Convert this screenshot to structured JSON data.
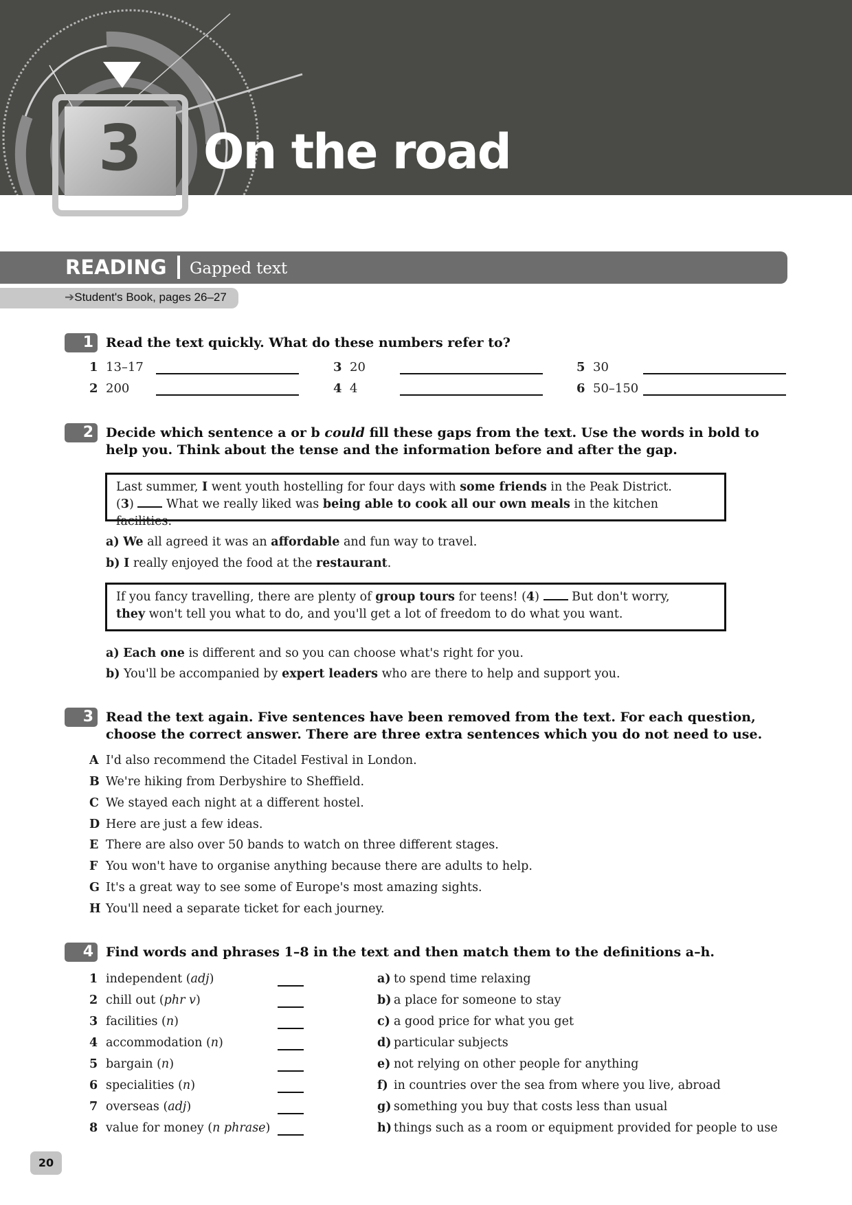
{
  "header": {
    "unit_number": "3",
    "unit_title": "On the road"
  },
  "section": {
    "title": "READING",
    "subtitle": "Gapped text",
    "book_ref_icon": "arrow-right-icon",
    "book_ref": "Student's Book, pages 26–27"
  },
  "exercise1": {
    "number": "1",
    "instruction": "Read the text quickly. What do these numbers refer to?",
    "items": [
      {
        "n": "1",
        "value": "13–17"
      },
      {
        "n": "2",
        "value": "200"
      },
      {
        "n": "3",
        "value": "20"
      },
      {
        "n": "4",
        "value": "4"
      },
      {
        "n": "5",
        "value": "30"
      },
      {
        "n": "6",
        "value": "50–150"
      }
    ]
  },
  "exercise2": {
    "number": "2",
    "instruction_pre": "Decide which sentence a or b ",
    "instruction_em": "could",
    "instruction_post": " fill these gaps from the text. Use the words in bold to help you. Think about the tense and the information before and after the gap.",
    "box1": {
      "l1_a": "Last summer, ",
      "l1_b": "I",
      "l1_c": " went youth hostelling for four days with ",
      "l1_d": "some friends",
      "l1_e": " in the Peak District.",
      "l2_a": "(",
      "l2_b": "3",
      "l2_c": ")",
      "l2_d": " What we really liked was ",
      "l2_e": "being able to cook all our own meals",
      "l2_f": " in the kitchen facilities."
    },
    "box1_options": [
      {
        "label": "a)",
        "bold": "We",
        "text_a": " all agreed it was an ",
        "bold2": "affordable",
        "text_b": " and fun way to travel."
      },
      {
        "label": "b)",
        "bold": "I",
        "text_a": " really enjoyed the food at the ",
        "bold2": "restaurant",
        "text_b": "."
      }
    ],
    "box2": {
      "l1_a": "If you fancy travelling, there are plenty of ",
      "l1_b": "group tours",
      "l1_c": " for teens! (",
      "l1_d": "4",
      "l1_e": ")",
      "l1_f": " But don't worry,",
      "l2_a": "they",
      "l2_b": " won't tell you what to do, and you'll get a lot of freedom to do what you want."
    },
    "box2_options": [
      {
        "label": "a)",
        "bold": "Each one",
        "text_a": " is different and so you can choose what's right for you.",
        "bold2": "",
        "text_b": ""
      },
      {
        "label": "b)",
        "bold": "",
        "text_a": "You'll be accompanied by ",
        "bold2": "expert leaders",
        "text_b": " who are there to help and support you."
      }
    ]
  },
  "exercise3": {
    "number": "3",
    "instruction": "Read the text again. Five sentences have been removed from the text. For each question, choose the correct answer. There are three extra sentences which you do not need to use.",
    "sentences": [
      {
        "label": "A",
        "text": "I'd also recommend the Citadel Festival in London."
      },
      {
        "label": "B",
        "text": "We're hiking from Derbyshire to Sheffield."
      },
      {
        "label": "C",
        "text": "We stayed each night at a different hostel."
      },
      {
        "label": "D",
        "text": "Here are just a few ideas."
      },
      {
        "label": "E",
        "text": "There are also over 50 bands to watch on three different stages."
      },
      {
        "label": "F",
        "text": "You won't have to organise anything because there are adults to help."
      },
      {
        "label": "G",
        "text": "It's a great way to see some of Europe's most amazing sights."
      },
      {
        "label": "H",
        "text": "You'll need a separate ticket for each journey."
      }
    ]
  },
  "exercise4": {
    "number": "4",
    "instruction": "Find words and phrases 1–8 in the text and then match them to the definitions a–h.",
    "words": [
      {
        "n": "1",
        "word": "independent",
        "pos": "adj"
      },
      {
        "n": "2",
        "word": "chill out",
        "pos": "phr v"
      },
      {
        "n": "3",
        "word": "facilities",
        "pos": "n"
      },
      {
        "n": "4",
        "word": "accommodation",
        "pos": "n"
      },
      {
        "n": "5",
        "word": "bargain",
        "pos": "n"
      },
      {
        "n": "6",
        "word": "specialities",
        "pos": "n"
      },
      {
        "n": "7",
        "word": "overseas",
        "pos": "adj"
      },
      {
        "n": "8",
        "word": "value for money",
        "pos": "n phrase"
      }
    ],
    "definitions": [
      {
        "label": "a)",
        "text": "to spend time relaxing"
      },
      {
        "label": "b)",
        "text": "a place for someone to stay"
      },
      {
        "label": "c)",
        "text": "a good price for what you get"
      },
      {
        "label": "d)",
        "text": "particular subjects"
      },
      {
        "label": "e)",
        "text": "not relying on other people for anything"
      },
      {
        "label": "f)",
        "text": "in countries over the sea from where you live, abroad"
      },
      {
        "label": "g)",
        "text": "something you buy that costs less than usual"
      },
      {
        "label": "h)",
        "text": "things such as a room or equipment provided for people to use"
      }
    ]
  },
  "footer": {
    "page_number": "20"
  }
}
